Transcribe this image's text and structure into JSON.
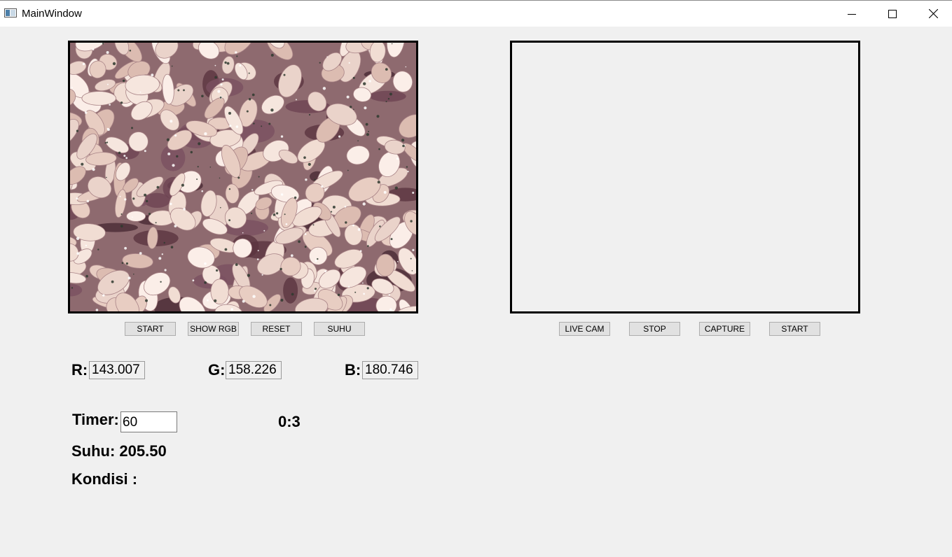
{
  "window": {
    "title": "MainWindow"
  },
  "left_panel": {
    "image_description": "close-up photo of fermenting soybeans",
    "buttons": {
      "start": "START",
      "show_rgb": "SHOW RGB",
      "reset": "RESET",
      "suhu": "SUHU"
    }
  },
  "right_panel": {
    "buttons": {
      "live_cam": "LIVE CAM",
      "stop": "STOP",
      "capture": "CAPTURE",
      "start": "START"
    }
  },
  "rgb": {
    "r_label": "R:",
    "r_value": "143.007",
    "g_label": "G:",
    "g_value": "158.226",
    "b_label": "B:",
    "b_value": "180.746"
  },
  "timer": {
    "label": "Timer:",
    "value": "60",
    "countdown": "0:3"
  },
  "suhu": {
    "text": "Suhu: 205.50"
  },
  "kondisi": {
    "label": "Kondisi :"
  },
  "colors": {
    "background": "#f0f0f0",
    "frame_border": "#000000",
    "button_bg": "#e1e1e1"
  }
}
